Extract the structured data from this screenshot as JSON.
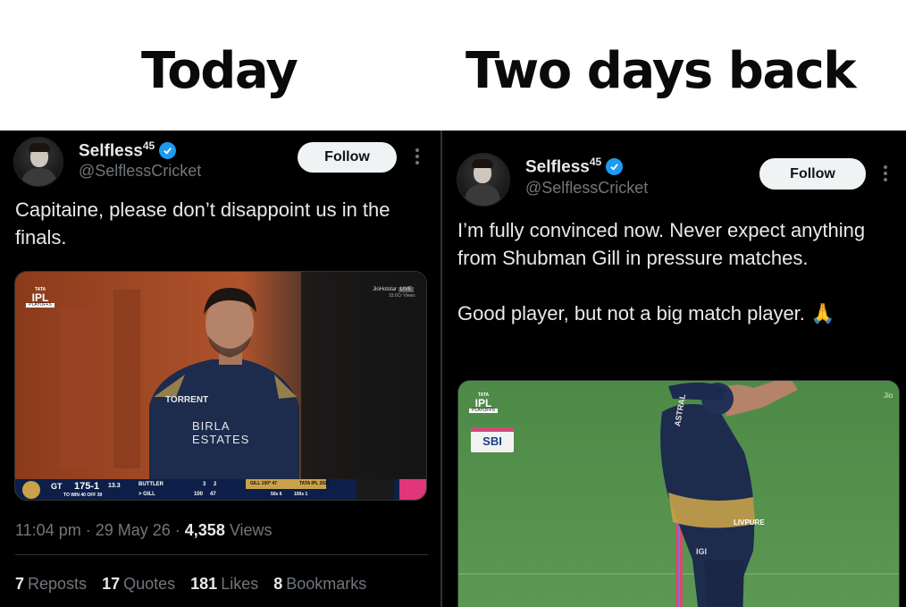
{
  "header": {
    "left_label": "Today",
    "right_label": "Two days back"
  },
  "left_tweet": {
    "display_name": "Selfless",
    "name_superscript": "45",
    "handle": "@SelflessCricket",
    "follow_label": "Follow",
    "text": "Capitaine, please don’t disappoint us in the finals.",
    "media": {
      "broadcaster": "JioHotstar",
      "live_badge": "LIVE",
      "views_small": "33.6Cr Views",
      "ipl_tata": "TATA",
      "ipl_label": "IPL",
      "ipl_sub": "PLAYOFFS",
      "jersey_sponsor_1": "TORRENT",
      "jersey_sponsor_2": "BIRLA",
      "jersey_sponsor_3": "ESTATES",
      "team": "GT",
      "score": "175-1",
      "overs": "13.3",
      "target": "TO WIN 40 OFF 39",
      "batter_1": "BUTTLER",
      "batter_1_score": "3",
      "batter_1_balls": "2",
      "batter_2": "> GILL",
      "batter_2_score": "100",
      "batter_2_balls": "47",
      "milestone": "GILL 100* 47",
      "milestone_tag": "TATA IPL 2026",
      "milestone_stats_1": "50s 6",
      "milestone_stats_2": "100s 1"
    },
    "time": "11:04 pm",
    "date": "29 May 26",
    "views_count": "4,358",
    "views_label": "Views",
    "stats": [
      {
        "count": "7",
        "label": "Reposts"
      },
      {
        "count": "17",
        "label": "Quotes"
      },
      {
        "count": "181",
        "label": "Likes"
      },
      {
        "count": "8",
        "label": "Bookmarks"
      }
    ]
  },
  "right_tweet": {
    "display_name": "Selfless",
    "name_superscript": "45",
    "handle": "@SelflessCricket",
    "follow_label": "Follow",
    "text": "I’m fully convinced now. Never expect anything from Shubman Gill in pressure matches.\n\nGood player, but not a big match player. 🙏",
    "media": {
      "broadcaster": "Jio",
      "ipl_tata": "TATA",
      "ipl_label": "IPL",
      "ipl_sub": "PLAYOFFS",
      "sponsor": "SBI",
      "jersey_text_1": "ASTRAL",
      "jersey_text_2": "LIVPURE",
      "jersey_text_3": "IGI"
    }
  },
  "colors": {
    "verified": "#1d9bf0",
    "gt_navy": "#1b2a4a",
    "gold": "#c8a24a",
    "pitch_green": "#4f8a4a"
  }
}
